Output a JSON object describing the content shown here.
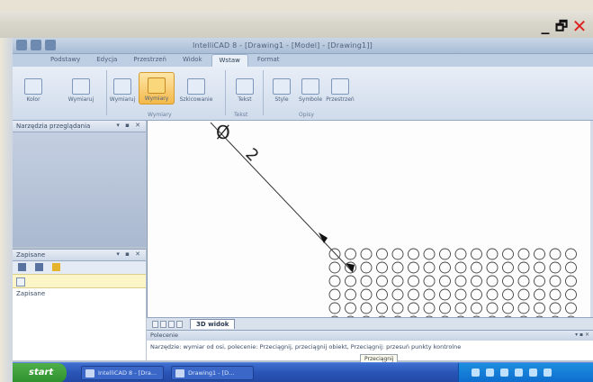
{
  "viewer": {
    "window_controls": {
      "minimize": "_",
      "maximize": "🗗",
      "close": "✕"
    }
  },
  "app": {
    "title": "IntelliCAD 8 - [Drawing1 - [Model] - [Drawing1]]",
    "tabs": [
      "Podstawy",
      "Edycja",
      "Przestrzeń",
      "Widok",
      "Wstaw",
      "Format"
    ],
    "active_tab_index": 4
  },
  "ribbon": {
    "buttons": [
      {
        "label": "Kolor",
        "highlight": false
      },
      {
        "label": "Wymiaruj",
        "highlight": false
      },
      {
        "label": "Wymiary",
        "highlight": true
      },
      {
        "label": "Szkicowanie",
        "highlight": false
      },
      {
        "label": "Tekst",
        "highlight": false
      },
      {
        "label": "Style",
        "highlight": false
      },
      {
        "label": "Symbole",
        "highlight": false
      },
      {
        "label": "Przestrzeń",
        "highlight": false
      }
    ],
    "groups": [
      "Wymiary",
      "Tekst",
      "Opisy"
    ]
  },
  "panels": {
    "top": {
      "title": "Narzędzia przeglądania"
    },
    "bottom": {
      "title": "Zapisane",
      "item": "Zapisane"
    }
  },
  "drawing": {
    "dimension_symbol": "Ø",
    "dimension_value": "2"
  },
  "sheet_tab": "3D widok",
  "command": {
    "title": "Polecenie",
    "text": "Narzędzie: wymiar od osi, polecenie: Przeciągnij, przeciągnij obiekt, Przeciągnij: przesuń punkty kontrolne"
  },
  "tooltip": "Przeciągnij",
  "taskbar": {
    "start": "start",
    "tasks": [
      "IntelliCAD 8 - [Dra...",
      "Drawing1 - [D..."
    ]
  }
}
